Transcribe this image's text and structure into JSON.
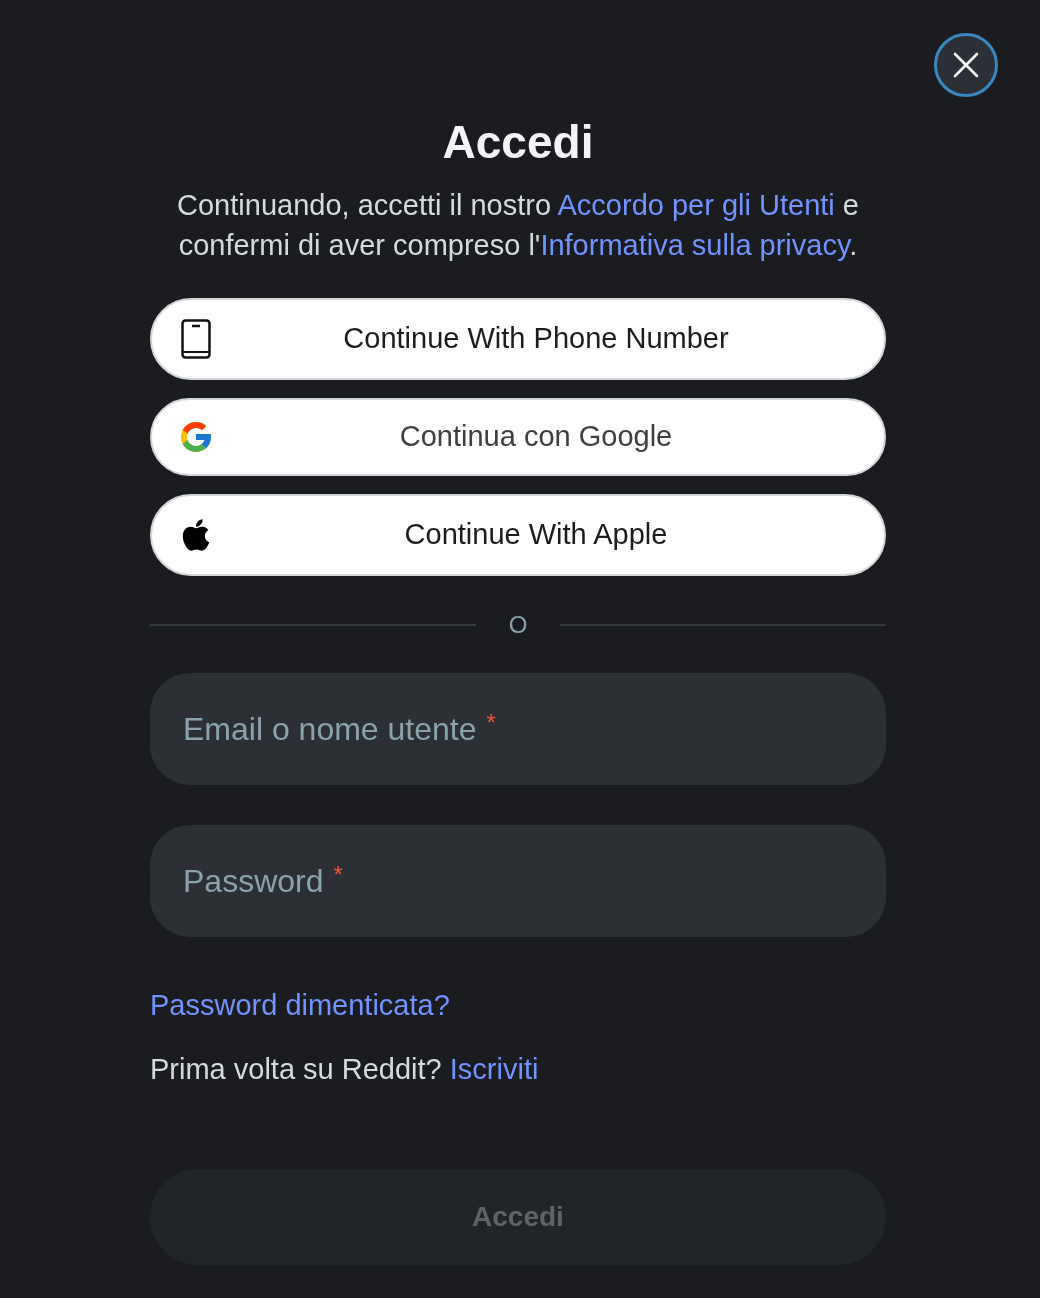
{
  "title": "Accedi",
  "terms": [
    {
      "kind": "text",
      "text": "Continuando, accetti il nostro "
    },
    {
      "kind": "link",
      "text": "Accordo per gli Utenti"
    },
    {
      "kind": "text",
      "text": " e confermi di aver compreso l'"
    },
    {
      "kind": "link",
      "text": "Informativa sulla privacy"
    },
    {
      "kind": "text",
      "text": "."
    }
  ],
  "social_buttons": [
    {
      "kind": "phone",
      "label": "Continue With Phone Number"
    },
    {
      "kind": "google",
      "label": "Continua con Google"
    },
    {
      "kind": "apple",
      "label": "Continue With Apple"
    }
  ],
  "divider": {
    "label": "O"
  },
  "fields": [
    {
      "placeholder": "Email o nome utente",
      "required_mark": "*"
    },
    {
      "placeholder": "Password",
      "required_mark": "*"
    }
  ],
  "forgot_password": "Password dimenticata?",
  "signup": [
    {
      "kind": "text",
      "text": "Prima volta su Reddit? "
    },
    {
      "kind": "link",
      "text": "Iscriviti"
    }
  ],
  "submit": {
    "label": "Accedi",
    "disabled": true
  }
}
